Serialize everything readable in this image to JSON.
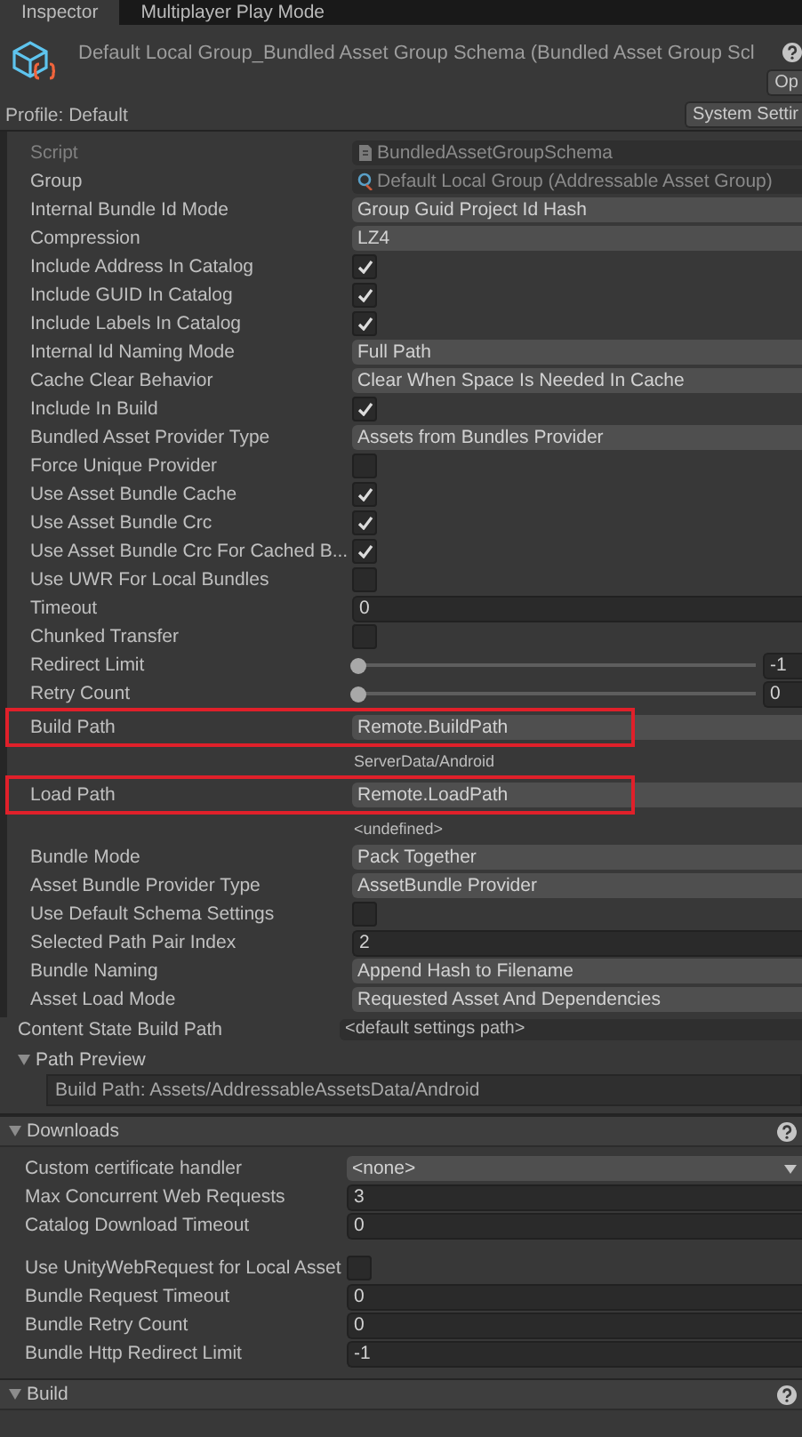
{
  "tabs": [
    {
      "label": "Inspector",
      "selected": true
    },
    {
      "label": "Multiplayer Play Mode",
      "selected": false
    }
  ],
  "header": {
    "title": "Default Local Group_Bundled Asset Group Schema (Bundled Asset Group Scl",
    "open_button": "Op",
    "profile": "Profile: Default",
    "settings_button": "System Settir"
  },
  "schema": {
    "rows": [
      {
        "kind": "script",
        "label": "Script",
        "value": "BundledAssetGroupSchema"
      },
      {
        "kind": "object",
        "label": "Group",
        "value": "Default Local Group (Addressable Asset Group)"
      },
      {
        "kind": "dropdown",
        "label": "Internal Bundle Id Mode",
        "value": "Group Guid Project Id Hash"
      },
      {
        "kind": "dropdown",
        "label": "Compression",
        "value": "LZ4"
      },
      {
        "kind": "check",
        "label": "Include Address In Catalog",
        "checked": true
      },
      {
        "kind": "check",
        "label": "Include GUID In Catalog",
        "checked": true
      },
      {
        "kind": "check",
        "label": "Include Labels In Catalog",
        "checked": true
      },
      {
        "kind": "dropdown",
        "label": "Internal Id Naming Mode",
        "value": "Full Path"
      },
      {
        "kind": "dropdown",
        "label": "Cache Clear Behavior",
        "value": "Clear When Space Is Needed In Cache"
      },
      {
        "kind": "check",
        "label": "Include In Build",
        "checked": true
      },
      {
        "kind": "dropdown",
        "label": "Bundled Asset Provider Type",
        "value": "Assets from Bundles Provider"
      },
      {
        "kind": "check",
        "label": "Force Unique Provider",
        "checked": false
      },
      {
        "kind": "check",
        "label": "Use Asset Bundle Cache",
        "checked": true
      },
      {
        "kind": "check",
        "label": "Use Asset Bundle Crc",
        "checked": true
      },
      {
        "kind": "check",
        "label": "Use Asset Bundle Crc For Cached B...",
        "checked": true
      },
      {
        "kind": "check",
        "label": "Use UWR For Local Bundles",
        "checked": false
      },
      {
        "kind": "field",
        "label": "Timeout",
        "value": "0"
      },
      {
        "kind": "check",
        "label": "Chunked Transfer",
        "checked": false
      },
      {
        "kind": "slider",
        "label": "Redirect Limit",
        "level": 0,
        "value": "-1"
      },
      {
        "kind": "slider",
        "label": "Retry Count",
        "level": 0,
        "value": "0"
      },
      {
        "kind": "dropdown",
        "label": "Build Path",
        "value": "Remote.BuildPath",
        "highlighted": true
      },
      {
        "kind": "note",
        "value": "ServerData/Android"
      },
      {
        "kind": "dropdown",
        "label": "Load Path",
        "value": "Remote.LoadPath",
        "highlighted": true
      },
      {
        "kind": "note",
        "value": "<undefined>"
      },
      {
        "kind": "dropdown",
        "label": "Bundle Mode",
        "value": "Pack Together"
      },
      {
        "kind": "dropdown",
        "label": "Asset Bundle Provider Type",
        "value": "AssetBundle Provider"
      },
      {
        "kind": "check",
        "label": "Use Default Schema Settings",
        "checked": false
      },
      {
        "kind": "field",
        "label": "Selected Path Pair Index",
        "value": "2"
      },
      {
        "kind": "dropdown",
        "label": "Bundle Naming",
        "value": "Append Hash to Filename"
      },
      {
        "kind": "dropdown",
        "label": "Asset Load Mode",
        "value": "Requested Asset And Dependencies"
      }
    ]
  },
  "content_state": {
    "label": "Content State Build Path",
    "value": "<default settings path>"
  },
  "path_preview": {
    "title": "Path Preview",
    "expanded": true,
    "text": "Build Path: Assets/AddressableAssetsData/Android"
  },
  "sections": [
    {
      "title": "Downloads",
      "expanded": true,
      "rows": [
        {
          "kind": "popup",
          "label": "Custom certificate handler",
          "value": "<none>"
        },
        {
          "kind": "field",
          "label": "Max Concurrent Web Requests",
          "value": "3"
        },
        {
          "kind": "field",
          "label": "Catalog Download Timeout",
          "value": "0"
        },
        {
          "kind": "check",
          "label": "Use UnityWebRequest for Local Asset",
          "checked": false
        },
        {
          "kind": "field",
          "label": "Bundle Request Timeout",
          "value": "0"
        },
        {
          "kind": "field",
          "label": "Bundle Retry Count",
          "value": "0"
        },
        {
          "kind": "field",
          "label": "Bundle Http Redirect Limit",
          "value": "-1"
        }
      ]
    },
    {
      "title": "Build",
      "expanded": true
    }
  ]
}
